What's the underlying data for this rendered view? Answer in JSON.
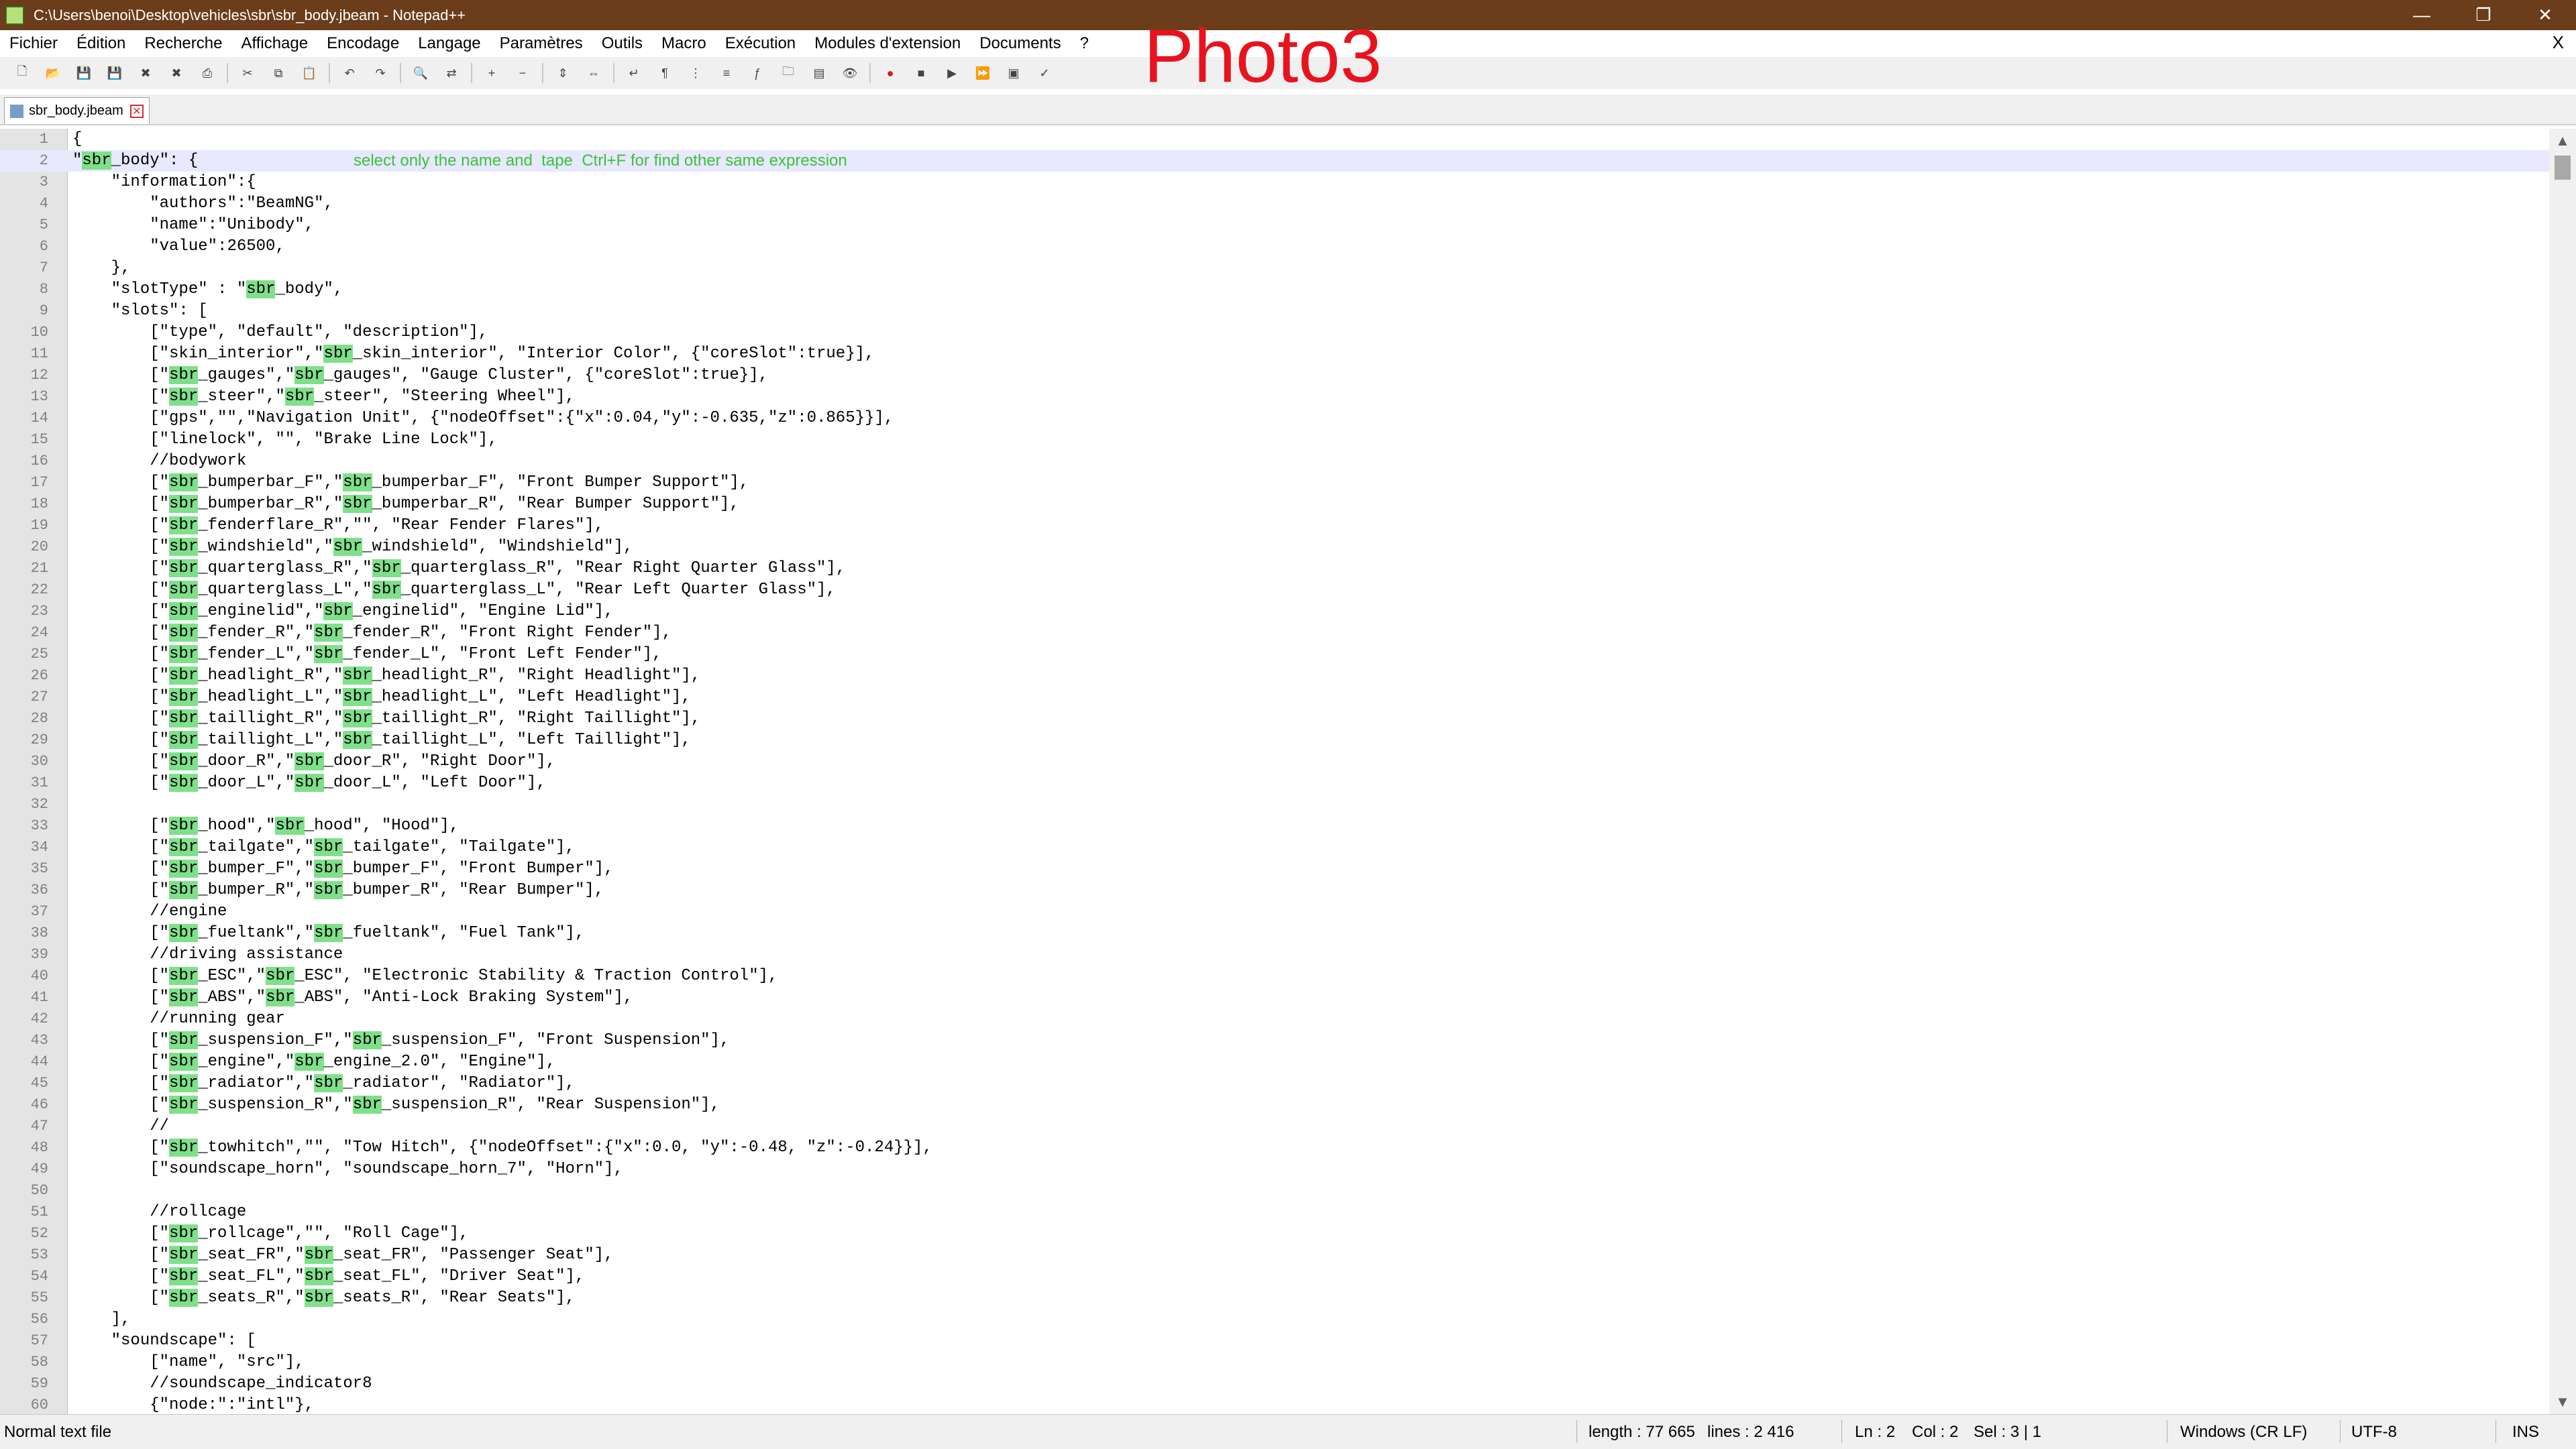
{
  "window": {
    "title": "C:\\Users\\benoi\\Desktop\\vehicles\\sbr\\sbr_body.jbeam - Notepad++",
    "minimize": "—",
    "restore": "❐",
    "close": "✕"
  },
  "overlay_label": "Photo3",
  "menu": [
    "Fichier",
    "Édition",
    "Recherche",
    "Affichage",
    "Encodage",
    "Langage",
    "Paramètres",
    "Outils",
    "Macro",
    "Exécution",
    "Modules d'extension",
    "Documents",
    "?"
  ],
  "menu_close": "X",
  "toolbar_icons": [
    "new-icon",
    "open-icon",
    "save-icon",
    "save-all-icon",
    "close-icon",
    "close-all-icon",
    "print-icon",
    "cut-icon",
    "copy-icon",
    "paste-icon",
    "undo-icon",
    "redo-icon",
    "find-icon",
    "replace-icon",
    "zoom-in-icon",
    "zoom-out-icon",
    "sync-vertical-icon",
    "sync-horizontal-icon",
    "word-wrap-icon",
    "show-all-chars-icon",
    "indent-guide-icon",
    "language-icon",
    "function-list-icon",
    "folder-workspace-icon",
    "doc-map-icon",
    "monitor-icon",
    "record-macro-icon",
    "stop-macro-icon",
    "play-macro-icon",
    "run-macro-multiple-icon",
    "save-macro-icon",
    "spellcheck-icon"
  ],
  "tab": {
    "label": "sbr_body.jbeam"
  },
  "editor": {
    "current_line": 2,
    "highlight_word": "sbr",
    "note": "select only the name and  tape  Ctrl+F for find other same expression",
    "lines": [
      "{",
      "\"sbr_body\": {",
      "    \"information\":{",
      "        \"authors\":\"BeamNG\",",
      "        \"name\":\"Unibody\",",
      "        \"value\":26500,",
      "    },",
      "    \"slotType\" : \"sbr_body\",",
      "    \"slots\": [",
      "        [\"type\", \"default\", \"description\"],",
      "        [\"skin_interior\",\"sbr_skin_interior\", \"Interior Color\", {\"coreSlot\":true}],",
      "        [\"sbr_gauges\",\"sbr_gauges\", \"Gauge Cluster\", {\"coreSlot\":true}],",
      "        [\"sbr_steer\",\"sbr_steer\", \"Steering Wheel\"],",
      "        [\"gps\",\"\",\"Navigation Unit\", {\"nodeOffset\":{\"x\":0.04,\"y\":-0.635,\"z\":0.865}}],",
      "        [\"linelock\", \"\", \"Brake Line Lock\"],",
      "        //bodywork",
      "        [\"sbr_bumperbar_F\",\"sbr_bumperbar_F\", \"Front Bumper Support\"],",
      "        [\"sbr_bumperbar_R\",\"sbr_bumperbar_R\", \"Rear Bumper Support\"],",
      "        [\"sbr_fenderflare_R\",\"\", \"Rear Fender Flares\"],",
      "        [\"sbr_windshield\",\"sbr_windshield\", \"Windshield\"],",
      "        [\"sbr_quarterglass_R\",\"sbr_quarterglass_R\", \"Rear Right Quarter Glass\"],",
      "        [\"sbr_quarterglass_L\",\"sbr_quarterglass_L\", \"Rear Left Quarter Glass\"],",
      "        [\"sbr_enginelid\",\"sbr_enginelid\", \"Engine Lid\"],",
      "        [\"sbr_fender_R\",\"sbr_fender_R\", \"Front Right Fender\"],",
      "        [\"sbr_fender_L\",\"sbr_fender_L\", \"Front Left Fender\"],",
      "        [\"sbr_headlight_R\",\"sbr_headlight_R\", \"Right Headlight\"],",
      "        [\"sbr_headlight_L\",\"sbr_headlight_L\", \"Left Headlight\"],",
      "        [\"sbr_taillight_R\",\"sbr_taillight_R\", \"Right Taillight\"],",
      "        [\"sbr_taillight_L\",\"sbr_taillight_L\", \"Left Taillight\"],",
      "        [\"sbr_door_R\",\"sbr_door_R\", \"Right Door\"],",
      "        [\"sbr_door_L\",\"sbr_door_L\", \"Left Door\"],",
      "",
      "        [\"sbr_hood\",\"sbr_hood\", \"Hood\"],",
      "        [\"sbr_tailgate\",\"sbr_tailgate\", \"Tailgate\"],",
      "        [\"sbr_bumper_F\",\"sbr_bumper_F\", \"Front Bumper\"],",
      "        [\"sbr_bumper_R\",\"sbr_bumper_R\", \"Rear Bumper\"],",
      "        //engine",
      "        [\"sbr_fueltank\",\"sbr_fueltank\", \"Fuel Tank\"],",
      "        //driving assistance",
      "        [\"sbr_ESC\",\"sbr_ESC\", \"Electronic Stability & Traction Control\"],",
      "        [\"sbr_ABS\",\"sbr_ABS\", \"Anti-Lock Braking System\"],",
      "        //running gear",
      "        [\"sbr_suspension_F\",\"sbr_suspension_F\", \"Front Suspension\"],",
      "        [\"sbr_engine\",\"sbr_engine_2.0\", \"Engine\"],",
      "        [\"sbr_radiator\",\"sbr_radiator\", \"Radiator\"],",
      "        [\"sbr_suspension_R\",\"sbr_suspension_R\", \"Rear Suspension\"],",
      "        //",
      "        [\"sbr_towhitch\",\"\", \"Tow Hitch\", {\"nodeOffset\":{\"x\":0.0, \"y\":-0.48, \"z\":-0.24}}],",
      "        [\"soundscape_horn\", \"soundscape_horn_7\", \"Horn\"],",
      "",
      "        //rollcage",
      "        [\"sbr_rollcage\",\"\", \"Roll Cage\"],",
      "        [\"sbr_seat_FR\",\"sbr_seat_FR\", \"Passenger Seat\"],",
      "        [\"sbr_seat_FL\",\"sbr_seat_FL\", \"Driver Seat\"],",
      "        [\"sbr_seats_R\",\"sbr_seats_R\", \"Rear Seats\"],",
      "    ],",
      "    \"soundscape\": [",
      "        [\"name\", \"src\"],",
      "        //soundscape_indicator8",
      "        {\"node:\":\"intl\"},"
    ]
  },
  "status": {
    "file_type": "Normal text file",
    "length": "length : 77 665",
    "lines": "lines : 2 416",
    "ln": "Ln : 2",
    "col": "Col : 2",
    "sel": "Sel : 3 | 1",
    "eol": "Windows (CR LF)",
    "encoding": "UTF-8",
    "mode": "INS"
  }
}
